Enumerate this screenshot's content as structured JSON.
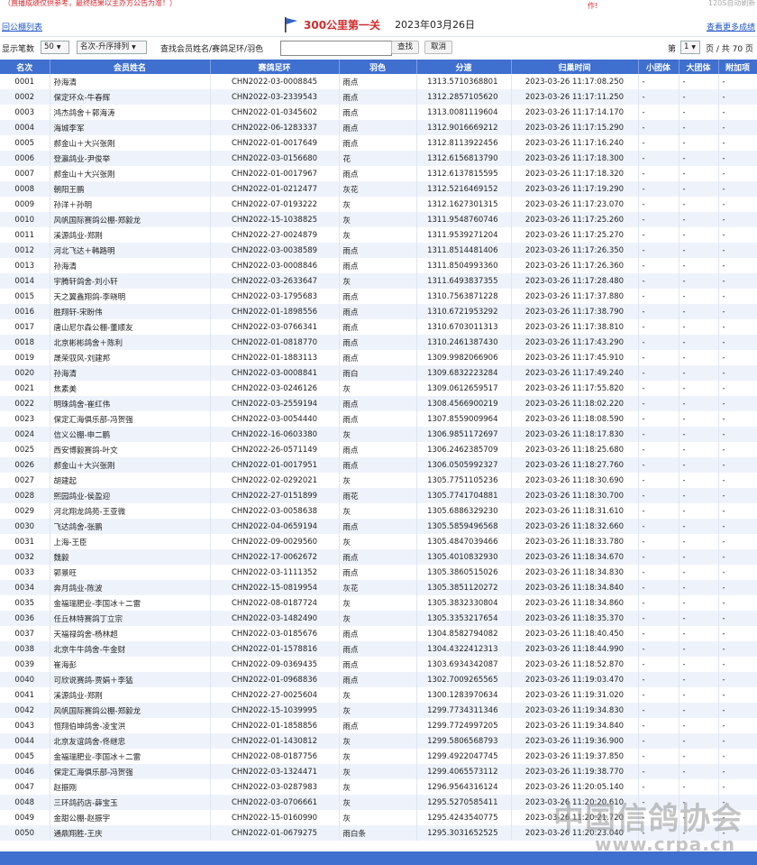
{
  "notice": {
    "left": "（直播成绩仅供参考，最终结果以主办方公告为准！）",
    "mid": "作!",
    "right": "120S自动刷新"
  },
  "header": {
    "back_link": "回公棚列表",
    "race_title": "300公里第一关",
    "race_date": "2023年03月26日",
    "more_link": "查看更多成绩"
  },
  "toolbar": {
    "page_size_label": "显示笔数",
    "page_size_value": "50",
    "sort_value": "名次-升序排列",
    "search_label": "查找会员姓名/赛鸽足环/羽色",
    "search_value": "",
    "search_button": "查找",
    "cancel_button": "取消",
    "page_prefix": "第",
    "page_value": "1",
    "page_suffix": "页 / 共 70 页"
  },
  "table": {
    "headers": [
      "名次",
      "会员姓名",
      "赛鸽足环",
      "羽色",
      "分速",
      "归巢时间",
      "小团体",
      "大团体",
      "附加项"
    ],
    "rows": [
      [
        "0001",
        "孙海清",
        "CHN2022-03-0008845",
        "雨点",
        "1313.5710368801",
        "2023-03-26 11:17:08.250",
        "-",
        "-",
        "-"
      ],
      [
        "0002",
        "保定环众-牛春辉",
        "CHN2022-03-2339543",
        "雨点",
        "1312.2857105620",
        "2023-03-26 11:17:11.250",
        "-",
        "-",
        "-"
      ],
      [
        "0003",
        "鸿杰鸽舍＋郭海涛",
        "CHN2022-01-0345602",
        "雨点",
        "1313.0081119604",
        "2023-03-26 11:17:14.170",
        "-",
        "-",
        "-"
      ],
      [
        "0004",
        "海城李军",
        "CHN2022-06-1283337",
        "雨点",
        "1312.9016669212",
        "2023-03-26 11:17:15.290",
        "-",
        "-",
        "-"
      ],
      [
        "0005",
        "郝金山＋大兴张刚",
        "CHN2022-01-0017649",
        "雨点",
        "1312.8113922456",
        "2023-03-26 11:17:16.240",
        "-",
        "-",
        "-"
      ],
      [
        "0006",
        "登瀛鸽业-尹俊举",
        "CHN2022-03-0156680",
        "花",
        "1312.6156813790",
        "2023-03-26 11:17:18.300",
        "-",
        "-",
        "-"
      ],
      [
        "0007",
        "郝金山＋大兴张刚",
        "CHN2022-01-0017967",
        "雨点",
        "1312.6137815595",
        "2023-03-26 11:17:18.320",
        "-",
        "-",
        "-"
      ],
      [
        "0008",
        "朝阳王鹏",
        "CHN2022-01-0212477",
        "灰花",
        "1312.5216469152",
        "2023-03-26 11:17:19.290",
        "-",
        "-",
        "-"
      ],
      [
        "0009",
        "孙洋＋孙明",
        "CHN2022-07-0193222",
        "灰",
        "1312.1627301315",
        "2023-03-26 11:17:23.070",
        "-",
        "-",
        "-"
      ],
      [
        "0010",
        "风帆国际赛鸽公棚-郑毅龙",
        "CHN2022-15-1038825",
        "灰",
        "1311.9548760746",
        "2023-03-26 11:17:25.260",
        "-",
        "-",
        "-"
      ],
      [
        "0011",
        "溪源鸽业-郑刚",
        "CHN2022-27-0024879",
        "灰",
        "1311.9539271204",
        "2023-03-26 11:17:25.270",
        "-",
        "-",
        "-"
      ],
      [
        "0012",
        "河北飞达＋韩路明",
        "CHN2022-03-0038589",
        "雨点",
        "1311.8514481406",
        "2023-03-26 11:17:26.350",
        "-",
        "-",
        "-"
      ],
      [
        "0013",
        "孙海清",
        "CHN2022-03-0008846",
        "雨点",
        "1311.8504993360",
        "2023-03-26 11:17:26.360",
        "-",
        "-",
        "-"
      ],
      [
        "0014",
        "宇腾轩鸽舍-刘小轩",
        "CHN2022-03-2633647",
        "灰",
        "1311.6493837355",
        "2023-03-26 11:17:28.480",
        "-",
        "-",
        "-"
      ],
      [
        "0015",
        "天之翼鑫翔鸽-李晓明",
        "CHN2022-03-1795683",
        "雨点",
        "1310.7563871228",
        "2023-03-26 11:17:37.880",
        "-",
        "-",
        "-"
      ],
      [
        "0016",
        "胜翔轩-宋盼伟",
        "CHN2022-01-1898556",
        "雨点",
        "1310.6721953292",
        "2023-03-26 11:17:38.790",
        "-",
        "-",
        "-"
      ],
      [
        "0017",
        "唐山尼尔森公棚-董顺友",
        "CHN2022-03-0766341",
        "雨点",
        "1310.6703011313",
        "2023-03-26 11:17:38.810",
        "-",
        "-",
        "-"
      ],
      [
        "0018",
        "北京彬彬鸽舍＋陈利",
        "CHN2022-01-0818770",
        "雨点",
        "1310.2461387430",
        "2023-03-26 11:17:43.290",
        "-",
        "-",
        "-"
      ],
      [
        "0019",
        "晟荣驭风-刘建邦",
        "CHN2022-01-1883113",
        "雨点",
        "1309.9982066906",
        "2023-03-26 11:17:45.910",
        "-",
        "-",
        "-"
      ],
      [
        "0020",
        "孙海清",
        "CHN2022-03-0008841",
        "雨白",
        "1309.6832223284",
        "2023-03-26 11:17:49.240",
        "-",
        "-",
        "-"
      ],
      [
        "0021",
        "焦素美",
        "CHN2022-03-0246126",
        "灰",
        "1309.0612659517",
        "2023-03-26 11:17:55.820",
        "-",
        "-",
        "-"
      ],
      [
        "0022",
        "明珠鸽舍-崔红伟",
        "CHN2022-03-2559194",
        "雨点",
        "1308.4566900219",
        "2023-03-26 11:18:02.220",
        "-",
        "-",
        "-"
      ],
      [
        "0023",
        "保定汇海俱乐部-冯贺强",
        "CHN2022-03-0054440",
        "雨点",
        "1307.8559009964",
        "2023-03-26 11:18:08.590",
        "-",
        "-",
        "-"
      ],
      [
        "0024",
        "信义公棚-申二鹏",
        "CHN2022-16-0603380",
        "灰",
        "1306.9851172697",
        "2023-03-26 11:18:17.830",
        "-",
        "-",
        "-"
      ],
      [
        "0025",
        "西安博毅赛鸽-叶文",
        "CHN2022-26-0571149",
        "雨点",
        "1306.2462385709",
        "2023-03-26 11:18:25.680",
        "-",
        "-",
        "-"
      ],
      [
        "0026",
        "郝金山＋大兴张刚",
        "CHN2022-01-0017951",
        "雨点",
        "1306.0505992327",
        "2023-03-26 11:18:27.760",
        "-",
        "-",
        "-"
      ],
      [
        "0027",
        "胡建起",
        "CHN2022-02-0292021",
        "灰",
        "1305.7751105236",
        "2023-03-26 11:18:30.690",
        "-",
        "-",
        "-"
      ],
      [
        "0028",
        "熙园鸽业-侯盈迎",
        "CHN2022-27-0151899",
        "雨花",
        "1305.7741704881",
        "2023-03-26 11:18:30.700",
        "-",
        "-",
        "-"
      ],
      [
        "0029",
        "河北翔龙鸽苑-王亚微",
        "CHN2022-03-0058638",
        "灰",
        "1305.6886329230",
        "2023-03-26 11:18:31.610",
        "-",
        "-",
        "-"
      ],
      [
        "0030",
        "飞达鸽舍-张鹏",
        "CHN2022-04-0659194",
        "雨点",
        "1305.5859496568",
        "2023-03-26 11:18:32.660",
        "-",
        "-",
        "-"
      ],
      [
        "0031",
        "上海-王臣",
        "CHN2022-09-0029560",
        "灰",
        "1305.4847039466",
        "2023-03-26 11:18:33.780",
        "-",
        "-",
        "-"
      ],
      [
        "0032",
        "魏毅",
        "CHN2022-17-0062672",
        "雨点",
        "1305.4010832930",
        "2023-03-26 11:18:34.670",
        "-",
        "-",
        "-"
      ],
      [
        "0033",
        "郭景旺",
        "CHN2022-03-1111352",
        "雨点",
        "1305.3860515026",
        "2023-03-26 11:18:34.830",
        "-",
        "-",
        "-"
      ],
      [
        "0034",
        "奔月鸽业-陈波",
        "CHN2022-15-0819954",
        "灰花",
        "1305.3851120272",
        "2023-03-26 11:18:34.840",
        "-",
        "-",
        "-"
      ],
      [
        "0035",
        "金福瑞肥业-李国冰＋二雷",
        "CHN2022-08-0187724",
        "灰",
        "1305.3832330804",
        "2023-03-26 11:18:34.860",
        "-",
        "-",
        "-"
      ],
      [
        "0036",
        "任丘林特赛鸽丁立宗",
        "CHN2022-03-1482490",
        "灰",
        "1305.3353217654",
        "2023-03-26 11:18:35.370",
        "-",
        "-",
        "-"
      ],
      [
        "0037",
        "天福禄鸽舍-杨林超",
        "CHN2022-03-0185676",
        "雨点",
        "1304.8582794082",
        "2023-03-26 11:18:40.450",
        "-",
        "-",
        "-"
      ],
      [
        "0038",
        "北京牛牛鸽舍-牛金财",
        "CHN2022-01-1578816",
        "雨点",
        "1304.4322412313",
        "2023-03-26 11:18:44.990",
        "-",
        "-",
        "-"
      ],
      [
        "0039",
        "崔海彭",
        "CHN2022-09-0369435",
        "雨点",
        "1303.6934342087",
        "2023-03-26 11:18:52.870",
        "-",
        "-",
        "-"
      ],
      [
        "0040",
        "可欣说赛鸽-贾娟＋李猛",
        "CHN2022-01-0968836",
        "雨点",
        "1302.7009265565",
        "2023-03-26 11:19:03.470",
        "-",
        "-",
        "-"
      ],
      [
        "0041",
        "溪源鸽业-郑刚",
        "CHN2022-27-0025604",
        "灰",
        "1300.1283970634",
        "2023-03-26 11:19:31.020",
        "-",
        "-",
        "-"
      ],
      [
        "0042",
        "风帆国际赛鸽公棚-郑毅龙",
        "CHN2022-15-1039995",
        "灰",
        "1299.7734311346",
        "2023-03-26 11:19:34.830",
        "-",
        "-",
        "-"
      ],
      [
        "0043",
        "恒翔伯坤鸽舍-凌宝洪",
        "CHN2022-01-1858856",
        "雨点",
        "1299.7724997205",
        "2023-03-26 11:19:34.840",
        "-",
        "-",
        "-"
      ],
      [
        "0044",
        "北京友谊鸽舍-佟继忠",
        "CHN2022-01-1430812",
        "灰",
        "1299.5806568793",
        "2023-03-26 11:19:36.900",
        "-",
        "-",
        "-"
      ],
      [
        "0045",
        "金福瑞肥业-李国冰＋二雷",
        "CHN2022-08-0187756",
        "灰",
        "1299.4922047745",
        "2023-03-26 11:19:37.850",
        "-",
        "-",
        "-"
      ],
      [
        "0046",
        "保定汇海俱乐部-冯贺强",
        "CHN2022-03-1324471",
        "灰",
        "1299.4065573112",
        "2023-03-26 11:19:38.770",
        "-",
        "-",
        "-"
      ],
      [
        "0047",
        "赵振刚",
        "CHN2022-03-0287983",
        "灰",
        "1296.9564316124",
        "2023-03-26 11:20:05.140",
        "-",
        "-",
        "-"
      ],
      [
        "0048",
        "三环鸽药店-薛宝玉",
        "CHN2022-03-0706661",
        "灰",
        "1295.5270585411",
        "2023-03-26 11:20:20.610",
        "-",
        "-",
        "-"
      ],
      [
        "0049",
        "金甜公棚-赵振宇",
        "CHN2022-15-0160990",
        "灰",
        "1295.4243540775",
        "2023-03-26 11:20:21.720",
        "-",
        "-",
        "-"
      ],
      [
        "0050",
        "通鼎翔胜-王庆",
        "CHN2022-01-0679275",
        "雨白条",
        "1295.3031652525",
        "2023-03-26 11:20:23.040",
        "-",
        "-",
        "-"
      ]
    ]
  },
  "watermark": {
    "line1": "中国信鸽协会",
    "line2": "www.crpa.cn"
  },
  "colors": {
    "header_bg": "#3f6fcf",
    "row_alt_bg": "#eef3fb",
    "link": "#1f56c9",
    "race_title": "#d12c2c"
  }
}
